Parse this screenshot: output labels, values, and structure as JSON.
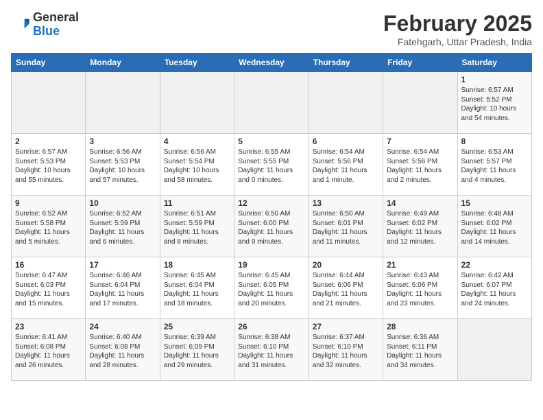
{
  "header": {
    "logo_general": "General",
    "logo_blue": "Blue",
    "month_title": "February 2025",
    "subtitle": "Fatehgarh, Uttar Pradesh, India"
  },
  "weekdays": [
    "Sunday",
    "Monday",
    "Tuesday",
    "Wednesday",
    "Thursday",
    "Friday",
    "Saturday"
  ],
  "weeks": [
    [
      {
        "day": "",
        "info": ""
      },
      {
        "day": "",
        "info": ""
      },
      {
        "day": "",
        "info": ""
      },
      {
        "day": "",
        "info": ""
      },
      {
        "day": "",
        "info": ""
      },
      {
        "day": "",
        "info": ""
      },
      {
        "day": "1",
        "info": "Sunrise: 6:57 AM\nSunset: 5:52 PM\nDaylight: 10 hours and 54 minutes."
      }
    ],
    [
      {
        "day": "2",
        "info": "Sunrise: 6:57 AM\nSunset: 5:53 PM\nDaylight: 10 hours and 55 minutes."
      },
      {
        "day": "3",
        "info": "Sunrise: 6:56 AM\nSunset: 5:53 PM\nDaylight: 10 hours and 57 minutes."
      },
      {
        "day": "4",
        "info": "Sunrise: 6:56 AM\nSunset: 5:54 PM\nDaylight: 10 hours and 58 minutes."
      },
      {
        "day": "5",
        "info": "Sunrise: 6:55 AM\nSunset: 5:55 PM\nDaylight: 11 hours and 0 minutes."
      },
      {
        "day": "6",
        "info": "Sunrise: 6:54 AM\nSunset: 5:56 PM\nDaylight: 11 hours and 1 minute."
      },
      {
        "day": "7",
        "info": "Sunrise: 6:54 AM\nSunset: 5:56 PM\nDaylight: 11 hours and 2 minutes."
      },
      {
        "day": "8",
        "info": "Sunrise: 6:53 AM\nSunset: 5:57 PM\nDaylight: 11 hours and 4 minutes."
      }
    ],
    [
      {
        "day": "9",
        "info": "Sunrise: 6:52 AM\nSunset: 5:58 PM\nDaylight: 11 hours and 5 minutes."
      },
      {
        "day": "10",
        "info": "Sunrise: 6:52 AM\nSunset: 5:59 PM\nDaylight: 11 hours and 6 minutes."
      },
      {
        "day": "11",
        "info": "Sunrise: 6:51 AM\nSunset: 5:59 PM\nDaylight: 11 hours and 8 minutes."
      },
      {
        "day": "12",
        "info": "Sunrise: 6:50 AM\nSunset: 6:00 PM\nDaylight: 11 hours and 9 minutes."
      },
      {
        "day": "13",
        "info": "Sunrise: 6:50 AM\nSunset: 6:01 PM\nDaylight: 11 hours and 11 minutes."
      },
      {
        "day": "14",
        "info": "Sunrise: 6:49 AM\nSunset: 6:02 PM\nDaylight: 11 hours and 12 minutes."
      },
      {
        "day": "15",
        "info": "Sunrise: 6:48 AM\nSunset: 6:02 PM\nDaylight: 11 hours and 14 minutes."
      }
    ],
    [
      {
        "day": "16",
        "info": "Sunrise: 6:47 AM\nSunset: 6:03 PM\nDaylight: 11 hours and 15 minutes."
      },
      {
        "day": "17",
        "info": "Sunrise: 6:46 AM\nSunset: 6:04 PM\nDaylight: 11 hours and 17 minutes."
      },
      {
        "day": "18",
        "info": "Sunrise: 6:45 AM\nSunset: 6:04 PM\nDaylight: 11 hours and 18 minutes."
      },
      {
        "day": "19",
        "info": "Sunrise: 6:45 AM\nSunset: 6:05 PM\nDaylight: 11 hours and 20 minutes."
      },
      {
        "day": "20",
        "info": "Sunrise: 6:44 AM\nSunset: 6:06 PM\nDaylight: 11 hours and 21 minutes."
      },
      {
        "day": "21",
        "info": "Sunrise: 6:43 AM\nSunset: 6:06 PM\nDaylight: 11 hours and 23 minutes."
      },
      {
        "day": "22",
        "info": "Sunrise: 6:42 AM\nSunset: 6:07 PM\nDaylight: 11 hours and 24 minutes."
      }
    ],
    [
      {
        "day": "23",
        "info": "Sunrise: 6:41 AM\nSunset: 6:08 PM\nDaylight: 11 hours and 26 minutes."
      },
      {
        "day": "24",
        "info": "Sunrise: 6:40 AM\nSunset: 6:08 PM\nDaylight: 11 hours and 28 minutes."
      },
      {
        "day": "25",
        "info": "Sunrise: 6:39 AM\nSunset: 6:09 PM\nDaylight: 11 hours and 29 minutes."
      },
      {
        "day": "26",
        "info": "Sunrise: 6:38 AM\nSunset: 6:10 PM\nDaylight: 11 hours and 31 minutes."
      },
      {
        "day": "27",
        "info": "Sunrise: 6:37 AM\nSunset: 6:10 PM\nDaylight: 11 hours and 32 minutes."
      },
      {
        "day": "28",
        "info": "Sunrise: 6:36 AM\nSunset: 6:11 PM\nDaylight: 11 hours and 34 minutes."
      },
      {
        "day": "",
        "info": ""
      }
    ]
  ]
}
